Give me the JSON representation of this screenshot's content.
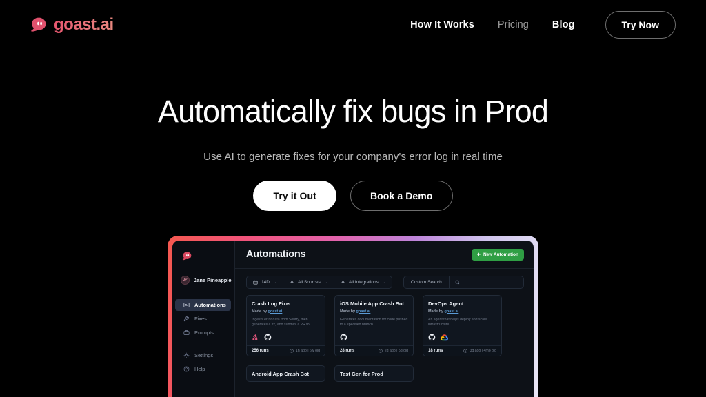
{
  "nav": {
    "brand": "goast.ai",
    "logo_icon": "ghost-icon",
    "links": [
      {
        "label": "How It Works",
        "dim": false
      },
      {
        "label": "Pricing",
        "dim": true
      },
      {
        "label": "Blog",
        "dim": false
      }
    ],
    "cta": "Try Now"
  },
  "hero": {
    "title": "Automatically fix bugs in Prod",
    "subtitle": "Use AI to generate fixes for your company's error log in real time",
    "primary_cta": "Try it Out",
    "secondary_cta": "Book a Demo"
  },
  "app": {
    "sidebar": {
      "logo_icon": "ghost-icon",
      "user": {
        "initials": "JP",
        "name": "Jane Pineapple"
      },
      "items": [
        {
          "label": "Automations",
          "icon": "monitor-icon",
          "active": true
        },
        {
          "label": "Fixes",
          "icon": "wrench-icon",
          "active": false
        },
        {
          "label": "Prompts",
          "icon": "briefcase-icon",
          "active": false
        }
      ],
      "footer_items": [
        {
          "label": "Settings",
          "icon": "gear-icon"
        },
        {
          "label": "Help",
          "icon": "help-circle-icon"
        }
      ]
    },
    "header": {
      "title": "Automations",
      "new_button": "New Automation",
      "new_button_color": "#2f9e44"
    },
    "filters": [
      {
        "label": "14D",
        "icon": "calendar-icon",
        "caret": true
      },
      {
        "label": "All Sources",
        "icon": "source-icon",
        "caret": true
      },
      {
        "label": "All Integrations",
        "icon": "integration-icon",
        "caret": true
      }
    ],
    "search": {
      "label": "Custom Search",
      "icon": "search-icon",
      "value": "",
      "placeholder": ""
    },
    "cards": [
      {
        "title": "Crash Log Fixer",
        "made_by_prefix": "Made by ",
        "made_by": "goast.ai",
        "description": "Ingests error data from Sentry, then generates a fix, and submits a PR to...",
        "integrations": [
          "sentry-icon",
          "github-icon"
        ],
        "runs": "256 runs",
        "meta": "1h ago | 6w old"
      },
      {
        "title": "iOS Mobile App Crash Bot",
        "made_by_prefix": "Made by ",
        "made_by": "goast.ai",
        "description": "Generates documentation for code pushed to a specified branch",
        "integrations": [
          "github-icon"
        ],
        "runs": "28 runs",
        "meta": "2d ago | 5d old"
      },
      {
        "title": "DevOps Agent",
        "made_by_prefix": "Made by ",
        "made_by": "goast.ai",
        "description": "An agent that helps deploy and scale infrastructure",
        "integrations": [
          "github-icon",
          "google-cloud-icon"
        ],
        "runs": "18 runs",
        "meta": "3d ago | 4mo old"
      },
      {
        "title": "Android App Crash Bot",
        "made_by_prefix": "",
        "made_by": "",
        "description": "",
        "integrations": [],
        "runs": "",
        "meta": ""
      },
      {
        "title": "Test Gen for Prod",
        "made_by_prefix": "",
        "made_by": "",
        "description": "",
        "integrations": [],
        "runs": "",
        "meta": ""
      }
    ]
  },
  "colors": {
    "background": "#000000",
    "brand_pink": "#e8566f",
    "accent_green": "#2f9e44",
    "frame_gradient_start": "#f4584f",
    "frame_gradient_end": "#e9e7f6"
  }
}
